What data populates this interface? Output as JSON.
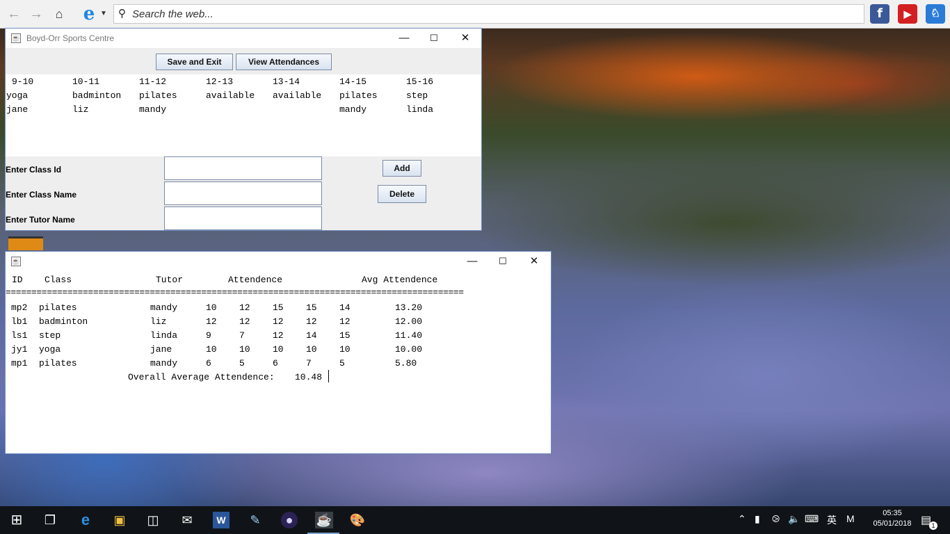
{
  "browser": {
    "search_placeholder": "Search the web...",
    "icons": [
      "back-arrow-icon",
      "forward-arrow-icon",
      "home-icon",
      "ie-icon",
      "facebook-icon",
      "youtube-icon",
      "games-icon"
    ]
  },
  "main_window": {
    "title": "Boyd-Orr Sports Centre",
    "buttons": {
      "save": "Save and Exit",
      "view": "View Attendances",
      "add": "Add",
      "delete": "Delete"
    },
    "timetable": {
      "times": [
        "9-10",
        "10-11",
        "11-12",
        "12-13",
        "13-14",
        "14-15",
        "15-16"
      ],
      "classes": [
        "yoga",
        "badminton",
        "pilates",
        "available",
        "available",
        "pilates",
        "step"
      ],
      "tutors": [
        "jane",
        "liz",
        "mandy",
        "",
        "",
        "mandy",
        "linda"
      ]
    },
    "form": {
      "class_id": "Enter Class Id",
      "class_name": "Enter Class Name",
      "tutor_name": "Enter Tutor Name"
    }
  },
  "report_window": {
    "headers": {
      "id": "ID",
      "class": "Class",
      "tutor": "Tutor",
      "attendance": "Attendence",
      "avg": "Avg Attendence"
    },
    "separator": "=========================================================================================",
    "rows": [
      {
        "id": "mp2",
        "class": "pilates",
        "tutor": "mandy",
        "a": [
          "10",
          "12",
          "15",
          "15",
          "14"
        ],
        "avg": "13.20"
      },
      {
        "id": "lb1",
        "class": "badminton",
        "tutor": "liz",
        "a": [
          "12",
          "12",
          "12",
          "12",
          "12"
        ],
        "avg": "12.00"
      },
      {
        "id": "ls1",
        "class": "step",
        "tutor": "linda",
        "a": [
          "9",
          "7",
          "12",
          "14",
          "15"
        ],
        "avg": "11.40"
      },
      {
        "id": "jy1",
        "class": "yoga",
        "tutor": "jane",
        "a": [
          "10",
          "10",
          "10",
          "10",
          "10"
        ],
        "avg": "10.00"
      },
      {
        "id": "mp1",
        "class": "pilates",
        "tutor": "mandy",
        "a": [
          "6",
          "5",
          "6",
          "7",
          "5"
        ],
        "avg": "5.80"
      }
    ],
    "overall_label": "Overall Average Attendence:",
    "overall_value": "10.48"
  },
  "taskbar": {
    "apps": [
      "start-icon",
      "task-view-icon",
      "edge-icon",
      "file-explorer-icon",
      "store-icon",
      "mail-icon",
      "word-icon",
      "notepad-icon",
      "eclipse-icon",
      "java-icon",
      "paint-icon"
    ],
    "ime": "英",
    "ime_mode": "M",
    "time": "05:35",
    "date": "05/01/2018",
    "notifications": "1"
  }
}
